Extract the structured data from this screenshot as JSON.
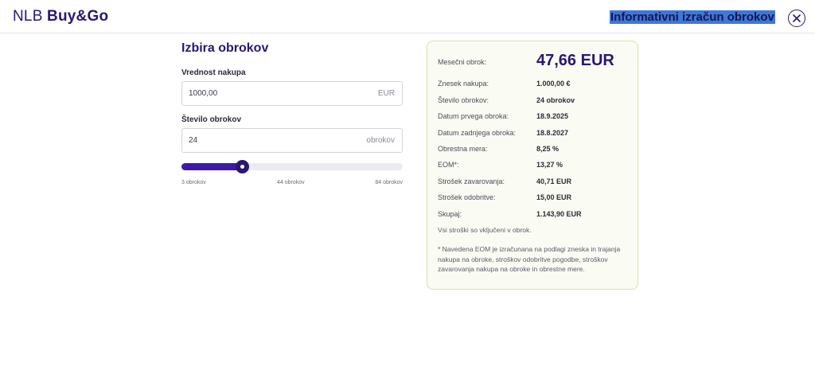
{
  "header": {
    "logo_thin": "NLB",
    "logo_bold": "Buy&Go",
    "title": "Informativni izračun obrokov"
  },
  "form": {
    "title": "Izbira obrokov",
    "amount": {
      "label": "Vrednost nakupa",
      "value": "1000,00",
      "unit": "EUR"
    },
    "installments": {
      "label": "Število obrokov",
      "value": "24",
      "unit": "obrokov"
    },
    "slider": {
      "min_label": "3 obrokov",
      "mid_label": "44 obrokov",
      "max_label": "84 obrokov",
      "min": 3,
      "max": 84,
      "value": 24
    }
  },
  "summary": {
    "monthly": {
      "label": "Mesečni obrok:",
      "value": "47,66 EUR"
    },
    "rows": [
      {
        "label": "Znesek nakupa:",
        "value": "1.000,00 €"
      },
      {
        "label": "Število obrokov:",
        "value": "24 obrokov"
      },
      {
        "label": "Datum prvega obroka:",
        "value": "18.9.2025"
      },
      {
        "label": "Datum zadnjega obroka:",
        "value": "18.8.2027"
      },
      {
        "label": "Obrestna mera:",
        "value": "8,25 %"
      },
      {
        "label": "EOM*:",
        "value": "13,27 %"
      },
      {
        "label": "Strošek zavarovanja:",
        "value": "40,71 EUR"
      },
      {
        "label": "Strošek odobritve:",
        "value": "15,00 EUR"
      },
      {
        "label": "Skupaj:",
        "value": "1.143,90 EUR"
      }
    ],
    "included_note": "Vsi stroški so vključeni v obrok.",
    "footnote": "* Navedena EOM je izračunana na podlagi zneska in trajanja nakupa na obroke, stroškov odobritve pogodbe, stroškov zavarovanja nakupa na obroke in obrestne mere."
  }
}
